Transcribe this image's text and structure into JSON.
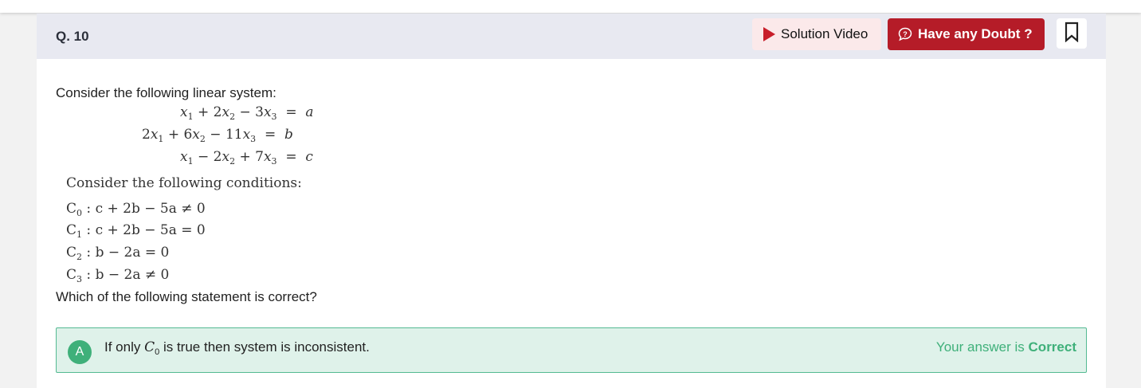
{
  "question": {
    "number": "Q. 10",
    "intro": "Consider the following linear system:",
    "equations": [
      {
        "lhs": [
          "x1",
          " + 2x2",
          " − 3x3"
        ],
        "rhs": "a"
      },
      {
        "lhs": [
          "2x1",
          " + 6x2",
          " − 11x3"
        ],
        "rhs": "b"
      },
      {
        "lhs": [
          "x1",
          " − 2x2",
          " + 7x3"
        ],
        "rhs": "c"
      }
    ],
    "conditions_heading": "Consider the following conditions:",
    "conditions": [
      {
        "label": "C0",
        "expr": "c + 2b − 5a ≠ 0"
      },
      {
        "label": "C1",
        "expr": "c + 2b − 5a = 0"
      },
      {
        "label": "C2",
        "expr": "b − 2a = 0"
      },
      {
        "label": "C3",
        "expr": "b − 2a ≠ 0"
      }
    ],
    "prompt": "Which of the following statement is correct?"
  },
  "toolbar": {
    "solution_video_label": "Solution Video",
    "have_doubt_label": "Have any Doubt ?"
  },
  "options": [
    {
      "letter": "A",
      "text_before": "If only ",
      "text_var": "C",
      "text_sub": "0",
      "text_after": " is true then system is inconsistent.",
      "result_prefix": "Your answer is ",
      "result_status": "Correct"
    }
  ],
  "colors": {
    "accent_red": "#b51c28",
    "correct_green": "#3fb07a",
    "correct_bg": "#dff2ea"
  },
  "icons": [
    "play-icon",
    "chat-question-icon",
    "bookmark-icon"
  ]
}
